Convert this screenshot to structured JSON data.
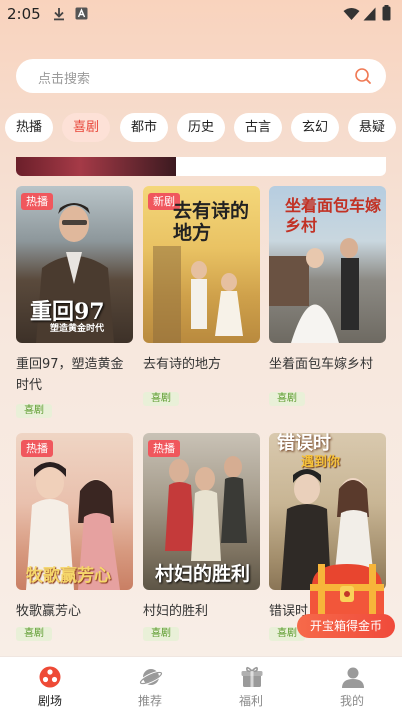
{
  "status_bar": {
    "time": "2:05"
  },
  "search": {
    "placeholder": "点击搜索"
  },
  "tabs": [
    {
      "label": "热播",
      "active": false
    },
    {
      "label": "喜剧",
      "active": true
    },
    {
      "label": "都市",
      "active": false
    },
    {
      "label": "历史",
      "active": false
    },
    {
      "label": "古言",
      "active": false
    },
    {
      "label": "玄幻",
      "active": false
    },
    {
      "label": "悬疑",
      "active": false
    }
  ],
  "dramas": [
    {
      "title": "重回97，塑造黄金时代",
      "badge": "热播",
      "genre": "喜剧",
      "poster_text": "重回97",
      "poster_sub": "塑造黄金时代"
    },
    {
      "title": "去有诗的地方",
      "badge": "新剧",
      "genre": "喜剧",
      "poster_text": "去有诗的地方",
      "poster_sub": ""
    },
    {
      "title": "坐着面包车嫁乡村",
      "badge": "",
      "genre": "喜剧",
      "poster_text": "坐着面包车嫁乡村",
      "poster_sub": ""
    },
    {
      "title": "牧歌赢芳心",
      "badge": "热播",
      "genre": "喜剧",
      "poster_text": "牧歌赢芳心",
      "poster_sub": ""
    },
    {
      "title": "村妇的胜利",
      "badge": "热播",
      "genre": "喜剧",
      "poster_text": "村妇的胜利",
      "poster_sub": ""
    },
    {
      "title": "错误时",
      "badge": "",
      "genre": "喜剧",
      "poster_text": "错误时",
      "poster_sub": "遇到你"
    }
  ],
  "floating_reward": {
    "label": "开宝箱得金币"
  },
  "bottom_nav": [
    {
      "label": "剧场",
      "icon": "theater-icon",
      "active": true
    },
    {
      "label": "推荐",
      "icon": "planet-icon",
      "active": false
    },
    {
      "label": "福利",
      "icon": "gift-icon",
      "active": false
    },
    {
      "label": "我的",
      "icon": "profile-icon",
      "active": false
    }
  ],
  "colors": {
    "accent": "#e8483b",
    "genre_green": "#5a9a2c",
    "badge_red": "#f0575d"
  }
}
